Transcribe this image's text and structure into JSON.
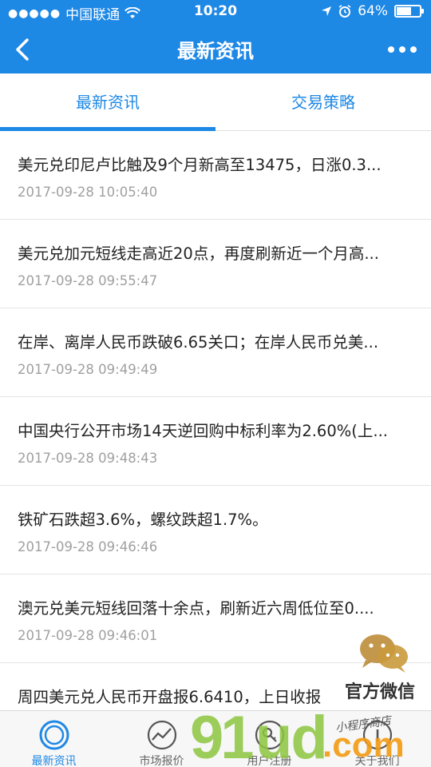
{
  "status_bar": {
    "signal": "●●●●●",
    "carrier": "中国联通",
    "time": "10:20",
    "battery": "64%",
    "battery_level": 0.64
  },
  "nav": {
    "title": "最新资讯"
  },
  "tabs": [
    {
      "label": "最新资讯",
      "active": true
    },
    {
      "label": "交易策略",
      "active": false
    }
  ],
  "news": [
    {
      "title": "美元兑印尼卢比触及9个月新高至13475，日涨0.3...",
      "time": "2017-09-28 10:05:40"
    },
    {
      "title": "美元兑加元短线走高近20点，再度刷新近一个月高...",
      "time": "2017-09-28 09:55:47"
    },
    {
      "title": "在岸、离岸人民币跌破6.65关口；在岸人民币兑美...",
      "time": "2017-09-28 09:49:49"
    },
    {
      "title": "中国央行公开市场14天逆回购中标利率为2.60%(上...",
      "time": "2017-09-28 09:48:43"
    },
    {
      "title": "铁矿石跌超3.6%，螺纹跌超1.7%。",
      "time": "2017-09-28 09:46:46"
    },
    {
      "title": "澳元兑美元短线回落十余点，刷新近六周低位至0....",
      "time": "2017-09-28 09:46:01"
    },
    {
      "title": "周四美元兑人民币开盘报6.6410，上日收报",
      "time": ""
    }
  ],
  "tabbar": [
    {
      "label": "最新资讯",
      "icon": "news-circle-icon",
      "active": true
    },
    {
      "label": "市场报价",
      "icon": "chart-trend-icon",
      "active": false
    },
    {
      "label": "用户注册",
      "icon": "user-key-icon",
      "active": false
    },
    {
      "label": "关于我们",
      "icon": "about-icon",
      "active": false
    }
  ],
  "watermark": {
    "brand_91": "91",
    "brand_ud": "ud",
    "brand_com": ".com",
    "shop": "小程序商店",
    "wechat": "官方微信"
  },
  "colors": {
    "primary": "#1e88e5",
    "watermark_green": "#8dc63f",
    "watermark_orange": "#f39c12"
  }
}
